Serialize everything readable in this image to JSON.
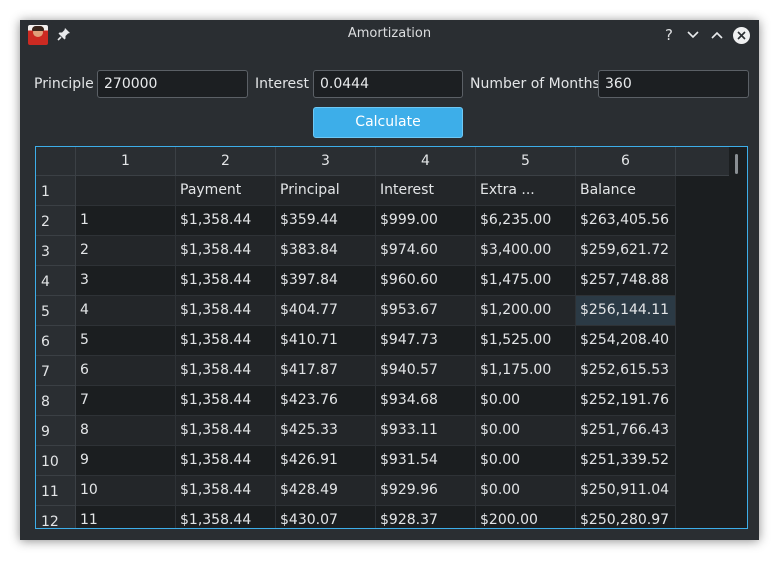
{
  "window": {
    "title": "Amortization"
  },
  "titlebar_icons": {
    "app": "app-avatar-icon",
    "pin": "pin-icon",
    "help": "?",
    "minimize": "chevron-down-icon",
    "maximize": "chevron-up-icon",
    "close": "close-circle-icon"
  },
  "form": {
    "principle_label": "Principle",
    "principle_value": "270000",
    "interest_label": "Interest",
    "interest_value": "0.0444",
    "months_label": "Number of Months",
    "months_value": "360",
    "calculate_label": "Calculate"
  },
  "table": {
    "column_headers": [
      "1",
      "2",
      "3",
      "4",
      "5",
      "6"
    ],
    "row_headers": [
      "1",
      "2",
      "3",
      "4",
      "5",
      "6",
      "7",
      "8",
      "9",
      "10",
      "11",
      "12"
    ],
    "selected_cell": {
      "row": 4,
      "col": 5
    },
    "rows": [
      [
        "",
        "Payment",
        "Principal",
        "Interest",
        "Extra ...",
        "Balance"
      ],
      [
        "1",
        "$1,358.44",
        "$359.44",
        "$999.00",
        "$6,235.00",
        "$263,405.56"
      ],
      [
        "2",
        "$1,358.44",
        "$383.84",
        "$974.60",
        "$3,400.00",
        "$259,621.72"
      ],
      [
        "3",
        "$1,358.44",
        "$397.84",
        "$960.60",
        "$1,475.00",
        "$257,748.88"
      ],
      [
        "4",
        "$1,358.44",
        "$404.77",
        "$953.67",
        "$1,200.00",
        "$256,144.11"
      ],
      [
        "5",
        "$1,358.44",
        "$410.71",
        "$947.73",
        "$1,525.00",
        "$254,208.40"
      ],
      [
        "6",
        "$1,358.44",
        "$417.87",
        "$940.57",
        "$1,175.00",
        "$252,615.53"
      ],
      [
        "7",
        "$1,358.44",
        "$423.76",
        "$934.68",
        "$0.00",
        "$252,191.76"
      ],
      [
        "8",
        "$1,358.44",
        "$425.33",
        "$933.11",
        "$0.00",
        "$251,766.43"
      ],
      [
        "9",
        "$1,358.44",
        "$426.91",
        "$931.54",
        "$0.00",
        "$251,339.52"
      ],
      [
        "10",
        "$1,358.44",
        "$428.49",
        "$929.96",
        "$0.00",
        "$250,911.04"
      ],
      [
        "11",
        "$1,358.44",
        "$430.07",
        "$928.37",
        "$200.00",
        "$250,280.97"
      ]
    ]
  },
  "colors": {
    "accent": "#3daee9",
    "window_bg": "#2a2e32",
    "table_bg": "#1b1e20",
    "alt_row_bg": "#232629"
  }
}
